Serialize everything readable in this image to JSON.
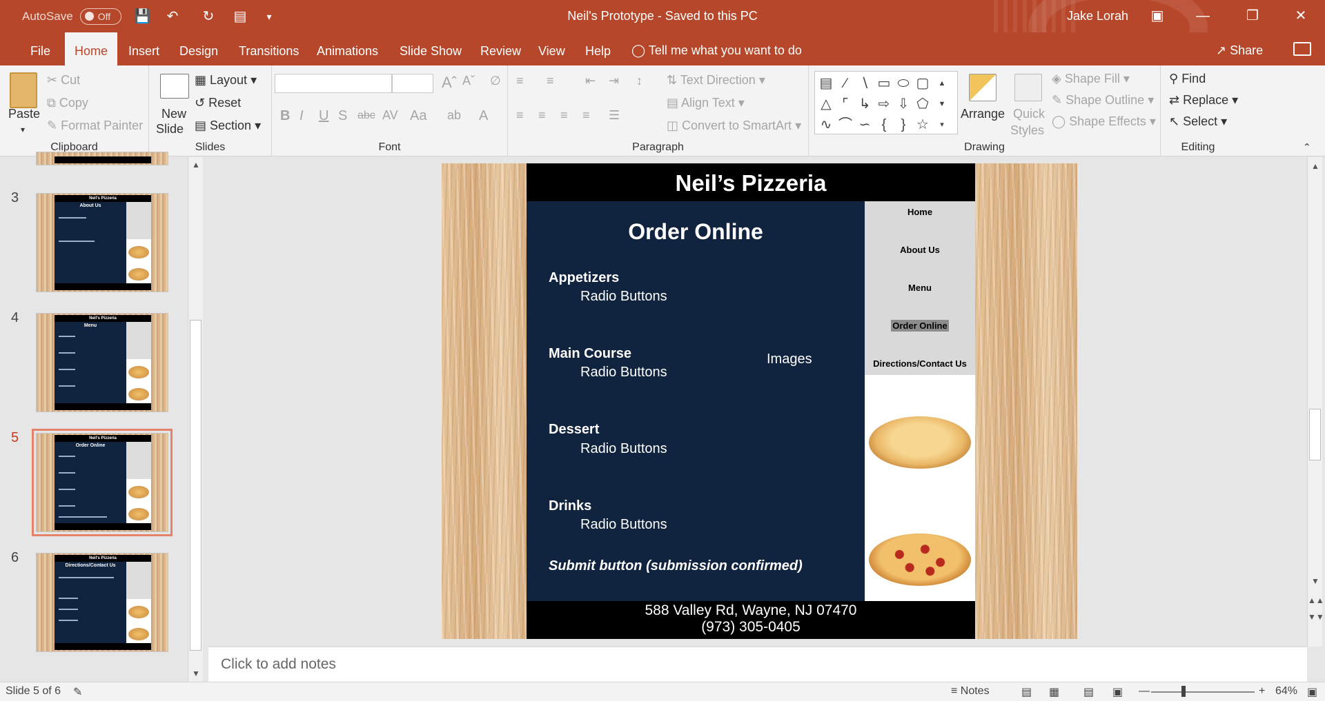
{
  "titlebar": {
    "autosave_label": "AutoSave",
    "autosave_state": "Off",
    "doc_title": "Neil's Prototype  -  Saved to this PC",
    "user": "Jake Lorah"
  },
  "tabs": [
    "File",
    "Home",
    "Insert",
    "Design",
    "Transitions",
    "Animations",
    "Slide Show",
    "Review",
    "View",
    "Help"
  ],
  "active_tab": "Home",
  "tell_me": "Tell me what you want to do",
  "share_label": "Share",
  "ribbon": {
    "clipboard": {
      "label": "Clipboard",
      "paste": "Paste",
      "cut": "Cut",
      "copy": "Copy",
      "format_painter": "Format Painter"
    },
    "slides": {
      "label": "Slides",
      "new_slide_1": "New",
      "new_slide_2": "Slide",
      "layout": "Layout",
      "reset": "Reset",
      "section": "Section"
    },
    "font": {
      "label": "Font"
    },
    "paragraph": {
      "label": "Paragraph",
      "text_direction": "Text Direction",
      "align_text": "Align Text",
      "convert_smartart": "Convert to SmartArt"
    },
    "drawing": {
      "label": "Drawing",
      "arrange": "Arrange",
      "quick_styles_1": "Quick",
      "quick_styles_2": "Styles",
      "shape_fill": "Shape Fill",
      "shape_outline": "Shape Outline",
      "shape_effects": "Shape Effects"
    },
    "editing": {
      "label": "Editing",
      "find": "Find",
      "replace": "Replace",
      "select": "Select"
    }
  },
  "thumbnails": [
    {
      "num": "3",
      "title": "Neil's Pizzeria",
      "subtitle": "About Us"
    },
    {
      "num": "4",
      "title": "Neil's Pizzeria",
      "subtitle": "Menu"
    },
    {
      "num": "5",
      "title": "Neil's Pizzeria",
      "subtitle": "Order Online"
    },
    {
      "num": "6",
      "title": "Neil's Pizzeria",
      "subtitle": "Directions/Contact Us"
    }
  ],
  "slide": {
    "header": "Neil’s Pizzeria",
    "title": "Order Online",
    "sections": [
      {
        "heading": "Appetizers",
        "item": "Radio Buttons"
      },
      {
        "heading": "Main Course",
        "item": "Radio Buttons"
      },
      {
        "heading": "Dessert",
        "item": "Radio Buttons"
      },
      {
        "heading": "Drinks",
        "item": "Radio Buttons"
      }
    ],
    "images_label": "Images",
    "submit": "Submit button (submission confirmed)",
    "nav": [
      "Home",
      "About Us",
      "Menu",
      "Order Online",
      "Directions/Contact Us"
    ],
    "current_nav": "Order Online",
    "address": "588 Valley Rd, Wayne, NJ 07470",
    "phone": "(973) 305-0405"
  },
  "notes_placeholder": "Click to add notes",
  "status": {
    "slide_info": "Slide 5 of 6",
    "notes_label": "Notes",
    "zoom": "64%"
  }
}
